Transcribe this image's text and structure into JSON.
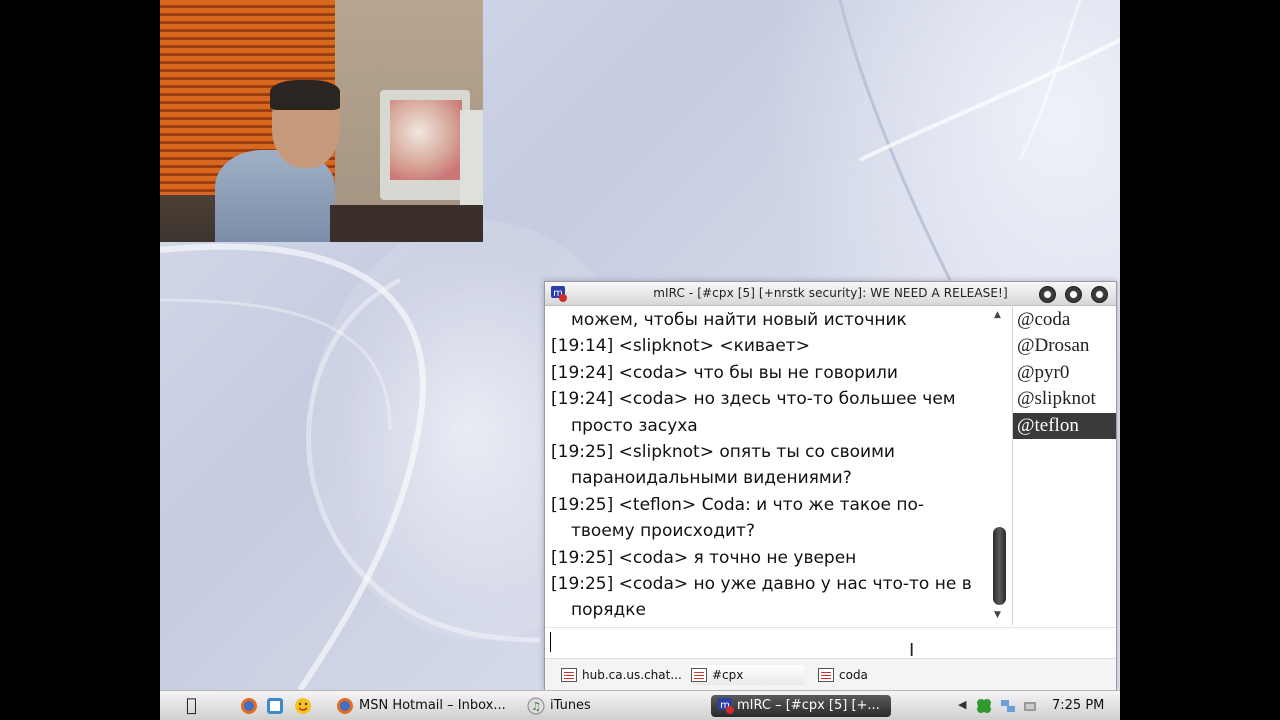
{
  "window": {
    "title": "mIRC - [#cpx [5] [+nrstk security]: WE NEED A RELEASE!]"
  },
  "chat": {
    "lines": [
      {
        "ts": "",
        "text": "можем, чтобы найти новый источник"
      },
      {
        "ts": "[19:14]",
        "text": "<slipknot> <кивает>"
      },
      {
        "ts": "[19:24]",
        "text": "<coda> что бы вы не говорили"
      },
      {
        "ts": "[19:24]",
        "text": "<coda> но здесь что-то большее чем просто засуха"
      },
      {
        "ts": "[19:25]",
        "text": "<slipknot> опять ты со своими параноидальными видениями?"
      },
      {
        "ts": "[19:25]",
        "text": "<teflon> Coda: и что же такое по-твоему происходит?"
      },
      {
        "ts": "[19:25]",
        "text": "<coda> я точно не уверен"
      },
      {
        "ts": "[19:25]",
        "text": "<coda> но уже давно у нас что-то не в порядке"
      }
    ]
  },
  "nicklist": {
    "nicks": [
      "@coda",
      "@Drosan",
      "@pyr0",
      "@slipknot",
      "@teflon"
    ],
    "selected": "@teflon"
  },
  "input": {
    "value": ""
  },
  "switchbar": {
    "items": [
      {
        "label": "hub.ca.us.chat...",
        "icon": "server-window-icon"
      },
      {
        "label": "#cpx",
        "icon": "channel-window-icon"
      },
      {
        "label": "coda",
        "icon": "query-window-icon"
      }
    ]
  },
  "taskbar": {
    "items": [
      {
        "label": "MSN Hotmail – Inbox...",
        "icon": "firefox-icon"
      },
      {
        "label": "iTunes",
        "icon": "itunes-icon"
      },
      {
        "label": "mIRC – [#cpx [5] [+...",
        "icon": "mirc-icon"
      }
    ],
    "clock": "7:25 PM"
  },
  "colors": {
    "selection": "#3a3a3a",
    "mirc_icon_red": "#d12b2b",
    "mirc_icon_blue": "#2a3fa8"
  }
}
